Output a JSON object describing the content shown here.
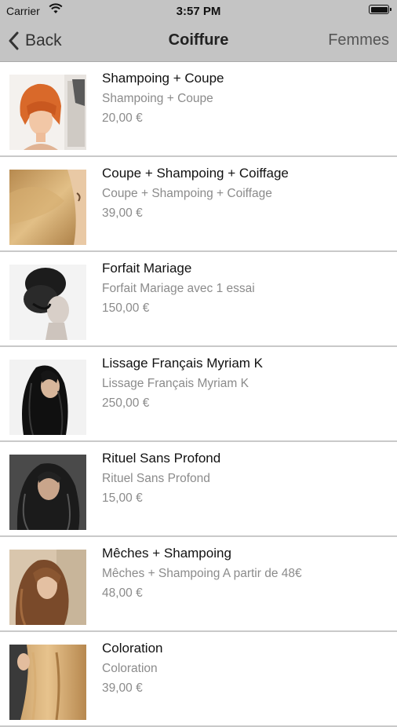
{
  "status_bar": {
    "carrier": "Carrier",
    "time": "3:57 PM",
    "wifi_icon": "wifi-icon",
    "battery_icon": "battery-icon"
  },
  "nav": {
    "back_label": "Back",
    "title": "Coiffure",
    "right_label": "Femmes"
  },
  "items": [
    {
      "name": "Shampoing + Coupe",
      "description": "Shampoing + Coupe",
      "price": "20,00 €"
    },
    {
      "name": "Coupe + Shampoing + Coiffage",
      "description": "Coupe + Shampoing + Coiffage",
      "price": "39,00 €"
    },
    {
      "name": "Forfait Mariage",
      "description": "Forfait Mariage avec 1 essai",
      "price": "150,00 €"
    },
    {
      "name": "Lissage Français Myriam K",
      "description": "Lissage Français Myriam K",
      "price": "250,00 €"
    },
    {
      "name": "Rituel Sans Profond",
      "description": "Rituel Sans Profond",
      "price": "15,00 €"
    },
    {
      "name": "Mêches + Shampoing",
      "description": "Mêches + Shampoing A partir de 48€",
      "price": "48,00 €"
    },
    {
      "name": "Coloration",
      "description": "Coloration",
      "price": "39,00 €"
    }
  ]
}
